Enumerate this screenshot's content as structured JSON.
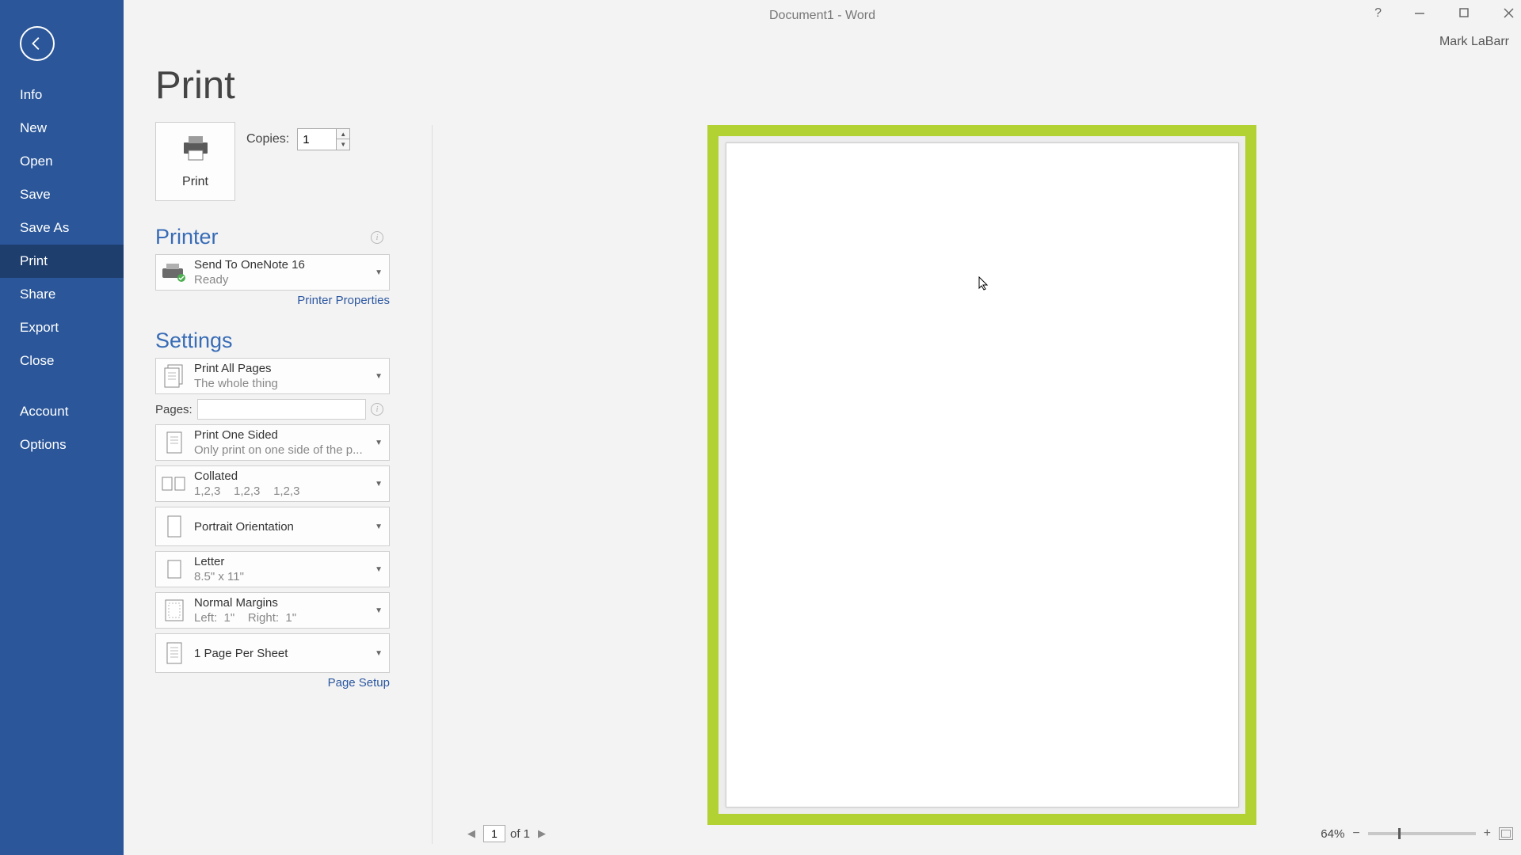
{
  "window": {
    "title": "Document1 - Word",
    "user": "Mark LaBarr"
  },
  "sidebar": {
    "items": [
      {
        "label": "Info"
      },
      {
        "label": "New"
      },
      {
        "label": "Open"
      },
      {
        "label": "Save"
      },
      {
        "label": "Save As"
      },
      {
        "label": "Print"
      },
      {
        "label": "Share"
      },
      {
        "label": "Export"
      },
      {
        "label": "Close"
      }
    ],
    "items2": [
      {
        "label": "Account"
      },
      {
        "label": "Options"
      }
    ]
  },
  "page": {
    "title": "Print"
  },
  "print": {
    "button": "Print",
    "copies_label": "Copies:",
    "copies_value": "1"
  },
  "printer": {
    "heading": "Printer",
    "selected": "Send To OneNote 16",
    "status": "Ready",
    "props_link": "Printer Properties"
  },
  "settings": {
    "heading": "Settings",
    "scope": {
      "title": "Print All Pages",
      "sub": "The whole thing"
    },
    "pages_label": "Pages:",
    "pages_value": "",
    "sides": {
      "title": "Print One Sided",
      "sub": "Only print on one side of the p..."
    },
    "collate": {
      "title": "Collated",
      "sub": "1,2,3    1,2,3    1,2,3"
    },
    "orientation": {
      "title": "Portrait Orientation"
    },
    "paper": {
      "title": "Letter",
      "sub": "8.5\" x 11\""
    },
    "margins": {
      "title": "Normal Margins",
      "sub": "Left:  1\"    Right:  1\""
    },
    "persheet": {
      "title": "1 Page Per Sheet"
    },
    "page_setup_link": "Page Setup"
  },
  "footer": {
    "page_current": "1",
    "page_of": "of 1",
    "zoom": "64%"
  }
}
